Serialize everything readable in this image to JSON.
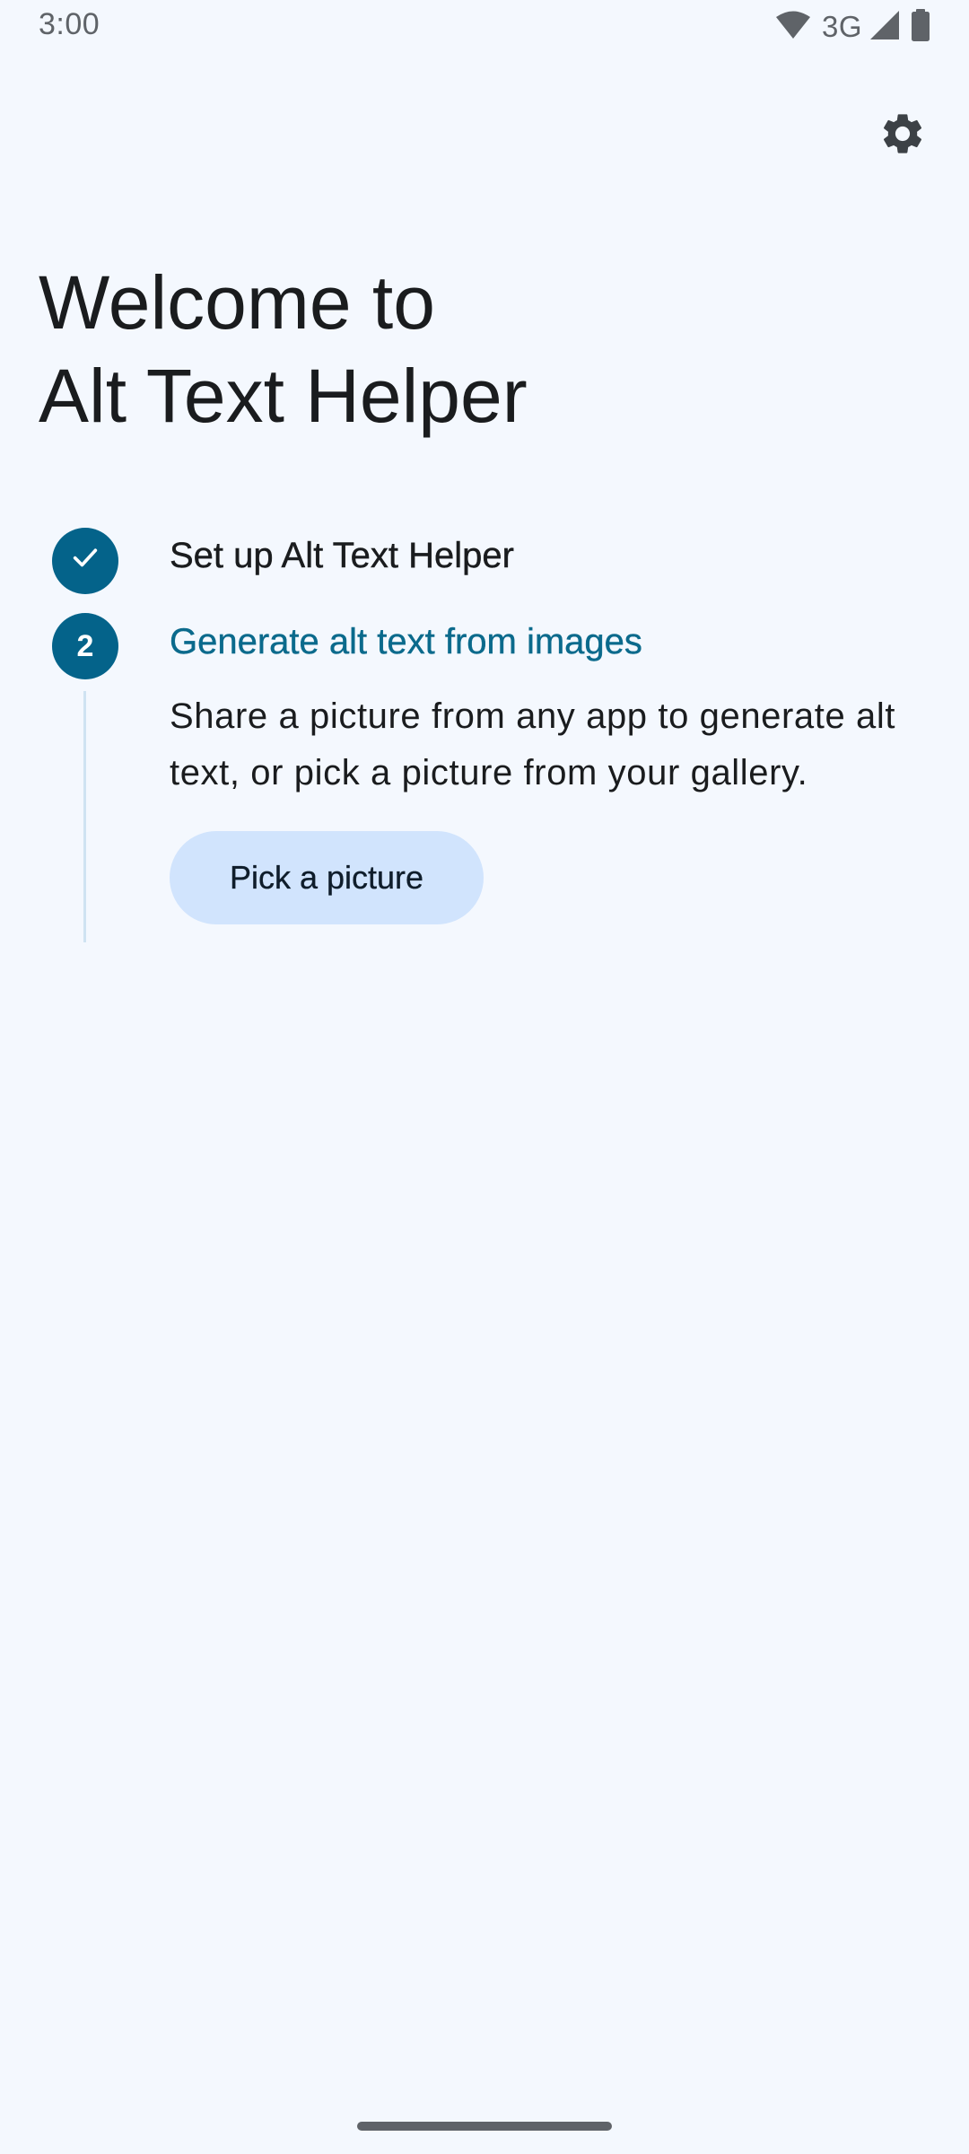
{
  "status_bar": {
    "time": "3:00",
    "network": "3G",
    "icons": [
      "wifi-icon",
      "cellular-signal-icon",
      "battery-icon"
    ]
  },
  "header": {
    "settings_icon": "gear-icon"
  },
  "title": {
    "line1": "Welcome to",
    "line2": "Alt Text Helper"
  },
  "steps": [
    {
      "marker": "check-icon",
      "title": "Set up Alt Text Helper",
      "completed": true
    },
    {
      "marker": "2",
      "title": "Generate alt text from images",
      "active": true,
      "description": "Share a picture from any app to generate alt text, or pick a picture from your gallery.",
      "button_label": "Pick a picture"
    }
  ],
  "colors": {
    "background": "#f4f8fe",
    "accent": "#04638a",
    "active_step_text": "#0b6a8c",
    "button_bg": "#d1e4fd"
  }
}
